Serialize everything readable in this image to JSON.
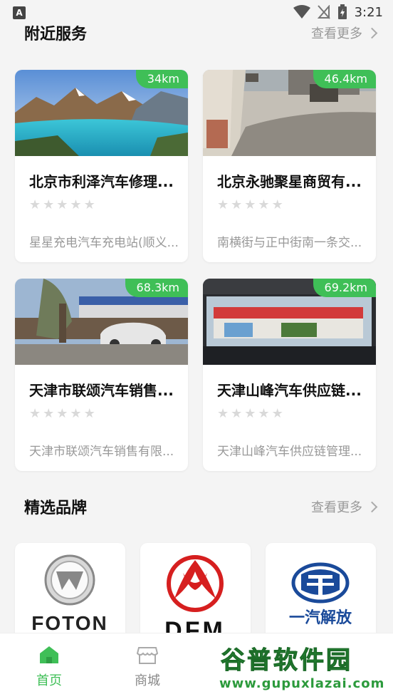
{
  "status_bar": {
    "app_badge": "A",
    "time": "3:21"
  },
  "nearby": {
    "title": "附近服务",
    "see_more": "查看更多",
    "cards": [
      {
        "distance": "34km",
        "name": "北京市利泽汽车修理...",
        "address": "星星充电汽车充电站(顺义...",
        "image": "mountain-lake-photo",
        "rating_stars": 0
      },
      {
        "distance": "46.4km",
        "name": "北京永驰聚星商贸有...",
        "address": "南横街与正中街南一条交...",
        "image": "yard-photo",
        "rating_stars": 0
      },
      {
        "distance": "68.3km",
        "name": "天津市联颂汽车销售...",
        "address": "天津市联颂汽车销售有限...",
        "image": "dealership-photo",
        "rating_stars": 0
      },
      {
        "distance": "69.2km",
        "name": "天津山峰汽车供应链...",
        "address": "天津山峰汽车供应链管理...",
        "image": "storefront-photo",
        "rating_stars": 0
      }
    ]
  },
  "brands": {
    "title": "精选品牌",
    "see_more": "查看更多",
    "items": [
      {
        "name": "foton",
        "logo_text": "FOTON"
      },
      {
        "name": "dongfeng",
        "logo_text": "DFM"
      },
      {
        "name": "faw-jiefang",
        "logo_text": "一汽解放"
      }
    ]
  },
  "bottom_nav": {
    "items": [
      {
        "label": "首页",
        "icon": "home-icon",
        "active": true
      },
      {
        "label": "商城",
        "icon": "store-icon",
        "active": false
      }
    ]
  },
  "watermark": {
    "title": "谷普软件园",
    "url": "www.gupuxlazai.com"
  },
  "colors": {
    "accent": "#3fbf57",
    "text_muted": "#999999",
    "background": "#f4f4f4"
  }
}
